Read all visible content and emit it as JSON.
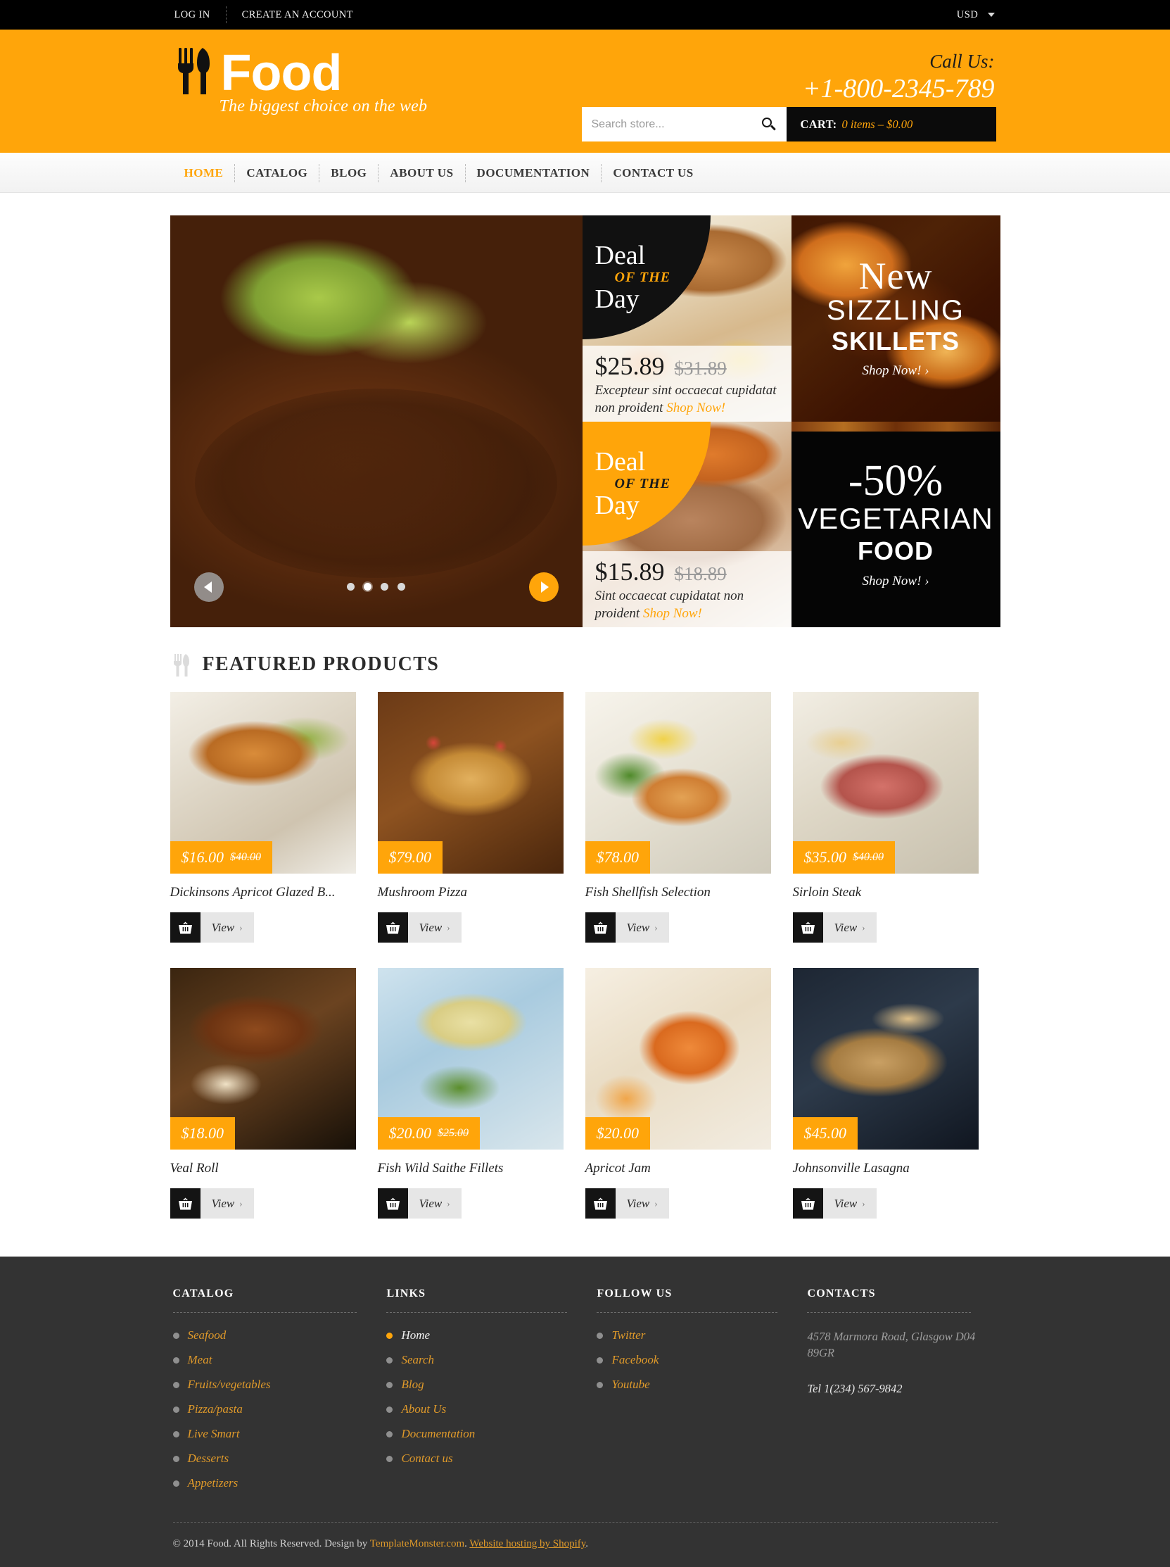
{
  "topbar": {
    "login": "LOG IN",
    "create_account": "CREATE AN ACCOUNT",
    "currency": "USD"
  },
  "header": {
    "logo_text": "Food",
    "tagline": "The biggest choice on the web",
    "call_label": "Call Us:",
    "phone": "+1-800-2345-789",
    "search_placeholder": "Search store...",
    "cart_label": "CART:",
    "cart_value": "0 items – $0.00",
    "accent_color": "#FFA50A"
  },
  "nav": {
    "items": [
      {
        "label": "HOME",
        "active": true
      },
      {
        "label": "CATALOG",
        "active": false
      },
      {
        "label": "BLOG",
        "active": false
      },
      {
        "label": "ABOUT US",
        "active": false
      },
      {
        "label": "DOCUMENTATION",
        "active": false
      },
      {
        "label": "CONTACT US",
        "active": false
      }
    ]
  },
  "hero": {
    "slider_dots": 4,
    "active_dot": 1,
    "deals": [
      {
        "badge_line1": "Deal",
        "badge_line2": "OF THE",
        "badge_line3": "Day",
        "badge_style": "black",
        "price": "$25.89",
        "old_price": "$31.89",
        "description": "Excepteur sint occaecat cupidatat non proident ",
        "cta": "Shop Now!"
      },
      {
        "badge_line1": "Deal",
        "badge_line2": "OF THE",
        "badge_line3": "Day",
        "badge_style": "orange",
        "price": "$15.89",
        "old_price": "$18.89",
        "description": "Sint occaecat cupidatat non proident ",
        "cta": "Shop Now!"
      }
    ],
    "promo_skillets": {
      "line1": "New",
      "line2": "SIZZLING",
      "line3": "SKILLETS",
      "cta": "Shop Now! ›"
    },
    "promo_vegetarian": {
      "line1": "-50%",
      "line2": "VEGETARIAN",
      "line3": "FOOD",
      "cta": "Shop Now! ›"
    }
  },
  "featured": {
    "title": "FEATURED PRODUCTS",
    "view_label": "View",
    "chevron": "›",
    "products": [
      {
        "name": "Dickinsons Apricot Glazed B...",
        "price": "$16.00",
        "old_price": "$40.00",
        "art": "pimg1"
      },
      {
        "name": "Mushroom Pizza",
        "price": "$79.00",
        "old_price": "",
        "art": "pimg2"
      },
      {
        "name": "Fish Shellfish Selection",
        "price": "$78.00",
        "old_price": "",
        "art": "pimg3"
      },
      {
        "name": "Sirloin Steak",
        "price": "$35.00",
        "old_price": "$40.00",
        "art": "pimg4"
      },
      {
        "name": "Veal Roll",
        "price": "$18.00",
        "old_price": "",
        "art": "pimg5"
      },
      {
        "name": "Fish Wild Saithe Fillets",
        "price": "$20.00",
        "old_price": "$25.00",
        "art": "pimg6"
      },
      {
        "name": "Apricot Jam",
        "price": "$20.00",
        "old_price": "",
        "art": "pimg7"
      },
      {
        "name": "Johnsonville Lasagna",
        "price": "$45.00",
        "old_price": "",
        "art": "pimg8"
      }
    ]
  },
  "footer": {
    "catalog": {
      "title": "CATALOG",
      "items": [
        "Seafood",
        "Meat",
        "Fruits/vegetables",
        "Pizza/pasta",
        "Live Smart",
        "Desserts",
        "Appetizers"
      ]
    },
    "links": {
      "title": "LINKS",
      "items": [
        "Home",
        "Search",
        "Blog",
        "About Us",
        "Documentation",
        "Contact us"
      ],
      "active_index": 0
    },
    "follow": {
      "title": "FOLLOW US",
      "items": [
        "Twitter",
        "Facebook",
        "Youtube"
      ]
    },
    "contacts": {
      "title": "CONTACTS",
      "address": "4578 Marmora Road, Glasgow D04 89GR",
      "tel": "Tel 1(234) 567-9842"
    },
    "copyright_pre": "© 2014 Food. All Rights Reserved. Design by ",
    "copyright_link1": "TemplateMonster.com",
    "copyright_mid": ". ",
    "copyright_link2": "Website hosting by Shopify",
    "copyright_end": "."
  }
}
